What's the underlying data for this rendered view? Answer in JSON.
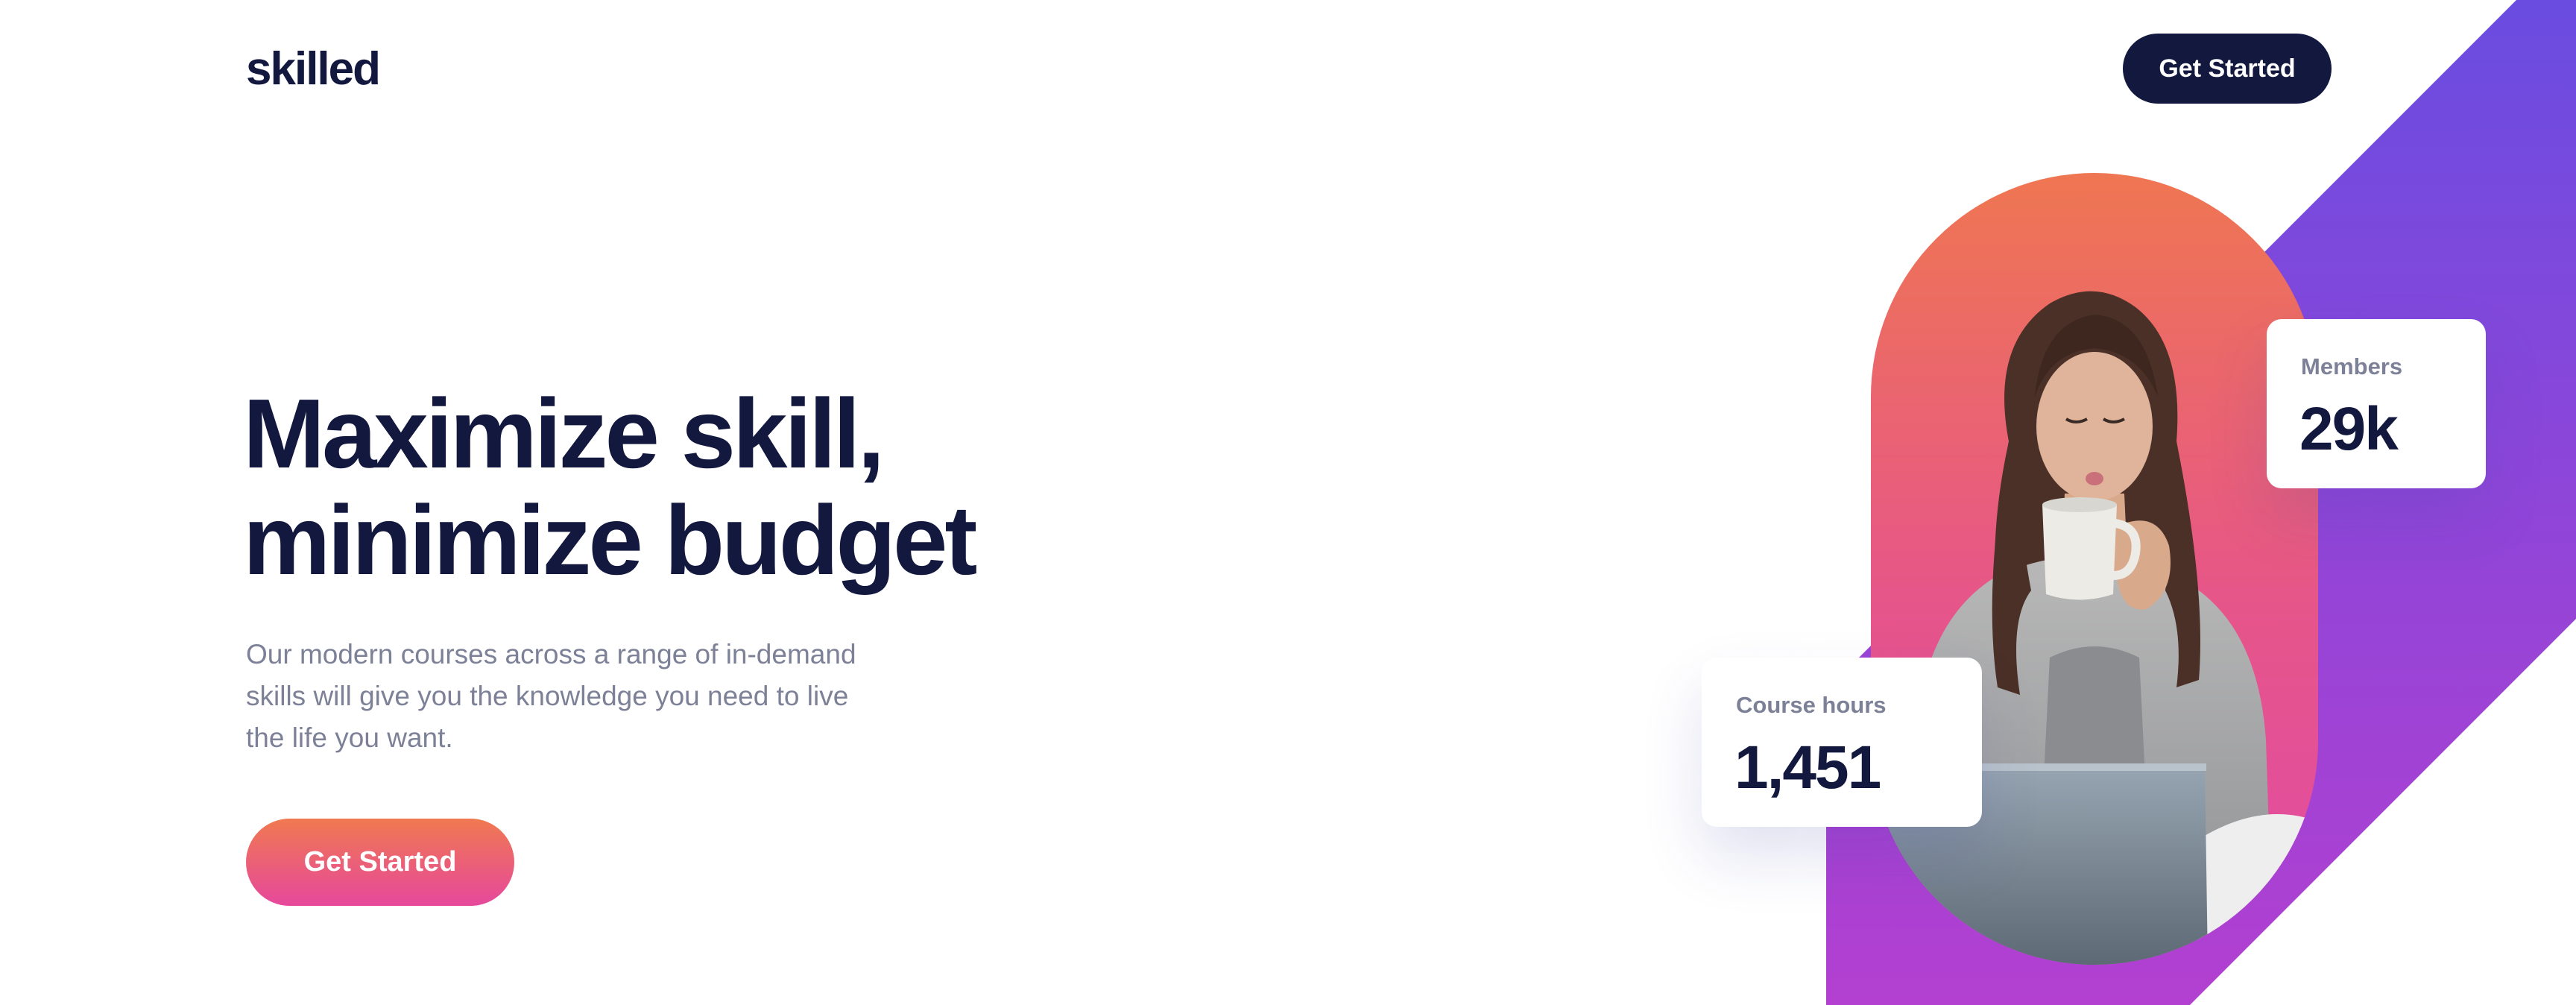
{
  "header": {
    "logo": "skilled",
    "cta_label": "Get Started"
  },
  "hero": {
    "headline_line1": "Maximize skill,",
    "headline_line2": "minimize budget",
    "lead_line1": "Our modern courses across a range of in-demand",
    "lead_line2": "skills will give you the knowledge you need to live",
    "lead_line3": "the life you want.",
    "cta_label": "Get Started"
  },
  "stats": {
    "members": {
      "label": "Members",
      "value": "29k"
    },
    "course_hours": {
      "label": "Course hours",
      "value": "1,451"
    }
  },
  "colors": {
    "navy": "#13183f",
    "body_text": "#7d8197",
    "gradient_orange": "#f07950",
    "gradient_pink": "#e6489c",
    "diag_purple_top": "#6a4ce0",
    "diag_purple_bottom": "#b53fd0"
  },
  "images": {
    "hero_photo": "woman-drinking-coffee-at-laptop"
  }
}
